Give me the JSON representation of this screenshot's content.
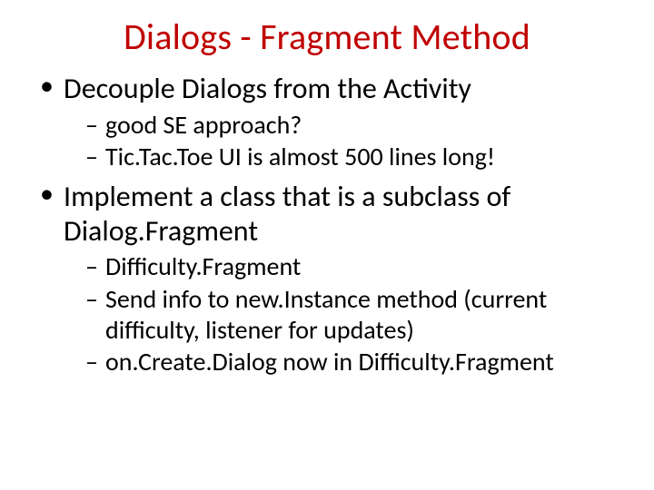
{
  "title": "Dialogs - Fragment Method",
  "bullets": [
    {
      "text": "Decouple Dialogs from the Activity",
      "sub": [
        "good SE approach?",
        "Tic.Tac.Toe UI is almost 500 lines long!"
      ]
    },
    {
      "text": "Implement a class that is a subclass of Dialog.Fragment",
      "sub": [
        "Difficulty.Fragment",
        "Send info to new.Instance method (current difficulty, listener for updates)",
        "on.Create.Dialog now in Difficulty.Fragment"
      ]
    }
  ]
}
